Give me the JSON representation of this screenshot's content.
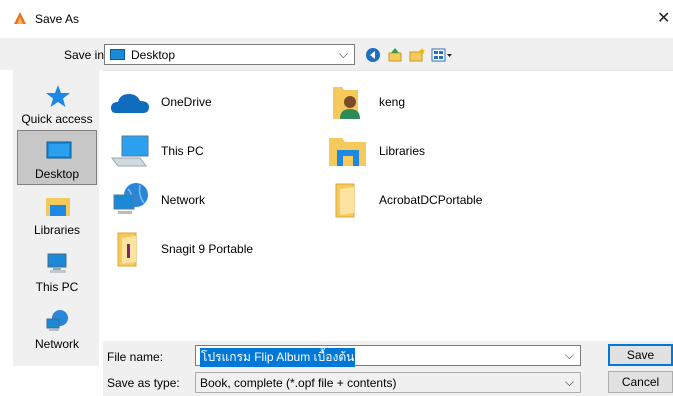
{
  "window": {
    "title": "Save As",
    "close_glyph": "✕"
  },
  "topbar": {
    "save_in_label": "Save in:",
    "location": "Desktop",
    "dropdown_glyph": "⌵",
    "tools": [
      "back-icon",
      "up-folder-icon",
      "new-folder-icon",
      "views-menu-icon"
    ]
  },
  "places": [
    {
      "label": "Quick access",
      "icon": "star-icon"
    },
    {
      "label": "Desktop",
      "icon": "desktop-icon",
      "selected": true
    },
    {
      "label": "Libraries",
      "icon": "libraries-icon"
    },
    {
      "label": "This PC",
      "icon": "computer-icon"
    },
    {
      "label": "Network",
      "icon": "network-icon"
    }
  ],
  "files": [
    {
      "name": "OneDrive",
      "icon": "cloud-icon"
    },
    {
      "name": "keng",
      "icon": "user-folder-icon"
    },
    {
      "name": "This PC",
      "icon": "computer-icon"
    },
    {
      "name": "Libraries",
      "icon": "libraries-icon"
    },
    {
      "name": "Network",
      "icon": "network-icon"
    },
    {
      "name": "AcrobatDCPortable",
      "icon": "folder-icon"
    },
    {
      "name": "Snagit 9 Portable",
      "icon": "folder-icon"
    }
  ],
  "bottom": {
    "file_name_label": "File name:",
    "file_name_value": "โปรแกรม Flip Album เบื้องต้น",
    "save_type_label": "Save as type:",
    "save_type_value": "Book, complete (*.opf file + contents)",
    "dropdown_glyph": "⌵",
    "save_button": "Save",
    "cancel_button": "Cancel"
  },
  "colors": {
    "accent": "#0078d7",
    "folder": "#f5c95a",
    "chrome": "#f0f0f0"
  }
}
